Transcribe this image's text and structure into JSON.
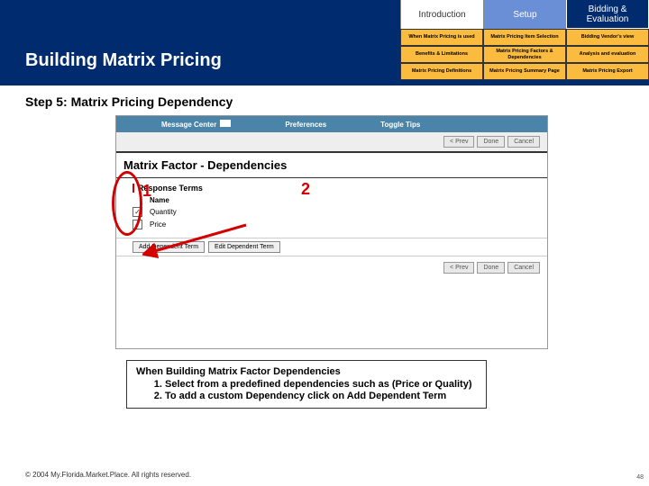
{
  "header": {
    "title": "Building Matrix Pricing"
  },
  "nav": {
    "tabs": [
      {
        "label": "Introduction"
      },
      {
        "label": "Setup"
      },
      {
        "label": "Bidding & Evaluation"
      }
    ],
    "sub": [
      "When Matrix Pricing is used",
      "Matrix Pricing Item Selection",
      "Bidding Vendor's view",
      "Benefits & Limitations",
      "Matrix Pricing Factors & Dependencies",
      "Analysis and evaluation",
      "Matrix Pricing Definitions",
      "Matrix Pricing Summary Page",
      "Matrix Pricing Export"
    ]
  },
  "step_title": "Step 5: Matrix Pricing Dependency",
  "screenshot": {
    "top_links": [
      "Message Center",
      "Preferences",
      "Toggle Tips"
    ],
    "btns": {
      "prev": "< Prev",
      "done": "Done",
      "cancel": "Cancel"
    },
    "heading": "Matrix Factor - Dependencies",
    "section": "Response Terms",
    "col_head": "Name",
    "rows": [
      {
        "label": "Quantity",
        "checked": true
      },
      {
        "label": "Price",
        "checked": true
      }
    ],
    "actions": {
      "add": "Add Dependent Term",
      "edit": "Edit Dependent Term"
    }
  },
  "markers": {
    "one": "1",
    "two": "2"
  },
  "info": {
    "title": "When Building Matrix Factor Dependencies",
    "items": [
      "Select from a predefined dependencies such as (Price or Quality)",
      "To add a custom Dependency click on Add Dependent Term"
    ]
  },
  "footer": "© 2004 My.Florida.Market.Place. All rights reserved.",
  "pagenum": "48"
}
